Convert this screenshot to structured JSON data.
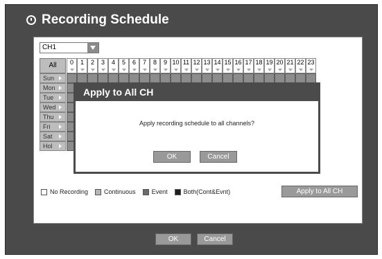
{
  "window": {
    "title": "Recording Schedule"
  },
  "channel_select": {
    "value": "CH1"
  },
  "grid": {
    "all_label": "All",
    "hours": [
      "0",
      "1",
      "2",
      "3",
      "4",
      "5",
      "6",
      "7",
      "8",
      "9",
      "10",
      "11",
      "12",
      "13",
      "14",
      "15",
      "16",
      "17",
      "18",
      "19",
      "20",
      "21",
      "22",
      "23"
    ],
    "days": [
      "Sun",
      "Mon",
      "Tue",
      "Wed",
      "Thu",
      "Fri",
      "Sat",
      "Hol"
    ],
    "cell_color": "#8c8c8c"
  },
  "legend": [
    {
      "label": "No Recording",
      "color": "#ffffff"
    },
    {
      "label": "Continuous",
      "color": "#b5b5b5"
    },
    {
      "label": "Event",
      "color": "#6a6a6a"
    },
    {
      "label": "Both(Cont&Evnt)",
      "color": "#1e1e1e"
    }
  ],
  "apply_to_all_label": "Apply to All CH",
  "dialog": {
    "title": "Apply to All CH",
    "message": "Apply recording schedule to all channels?",
    "ok_label": "OK",
    "cancel_label": "Cancel"
  },
  "footer": {
    "ok_label": "OK",
    "cancel_label": "Cancel"
  }
}
